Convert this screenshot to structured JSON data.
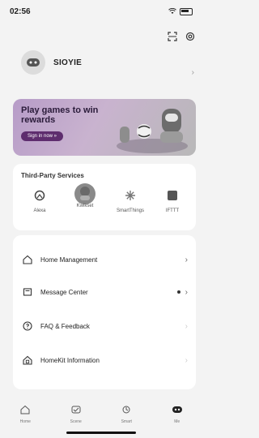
{
  "status_bar": {
    "time": "02:56"
  },
  "profile": {
    "username": "SIOYIE"
  },
  "banner": {
    "title": "Play games to win rewards",
    "button": "Sign in now »"
  },
  "third_party": {
    "title": "Third-Party Services",
    "items": [
      {
        "label": "Alexa",
        "icon": "alexa-icon"
      },
      {
        "label": "Kwikset",
        "icon": "kwikset-icon"
      },
      {
        "label": "SmartThings",
        "icon": "smartthings-icon"
      },
      {
        "label": "IFTTT",
        "icon": "ifttt-icon"
      }
    ]
  },
  "menu": {
    "items": [
      {
        "label": "Home Management",
        "icon": "home-icon"
      },
      {
        "label": "Message Center",
        "icon": "message-icon",
        "has_dot": true
      },
      {
        "label": "FAQ & Feedback",
        "icon": "question-icon"
      },
      {
        "label": "HomeKit Information",
        "icon": "homekit-icon"
      }
    ]
  },
  "bottom_nav": {
    "items": [
      {
        "label": "Home",
        "icon": "home-nav-icon"
      },
      {
        "label": "Scene",
        "icon": "scene-icon"
      },
      {
        "label": "Smart",
        "icon": "smart-icon"
      },
      {
        "label": "Me",
        "icon": "me-icon"
      }
    ]
  }
}
